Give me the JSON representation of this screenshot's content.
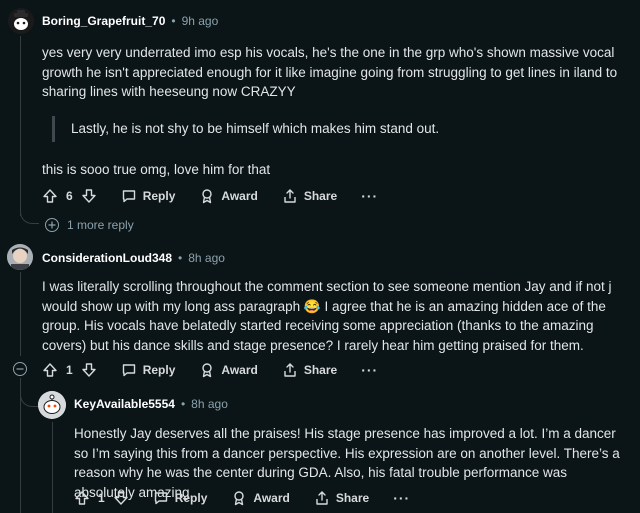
{
  "comments": [
    {
      "username": "Boring_Grapefruit_70",
      "time": "9h ago",
      "text": "yes very very underrated imo esp his vocals, he's the one in the grp who's shown massive vocal growth he isn't appreciated enough for it like imagine going from struggling to get lines in iland to sharing lines with heeseung now CRAZYY",
      "quote": "Lastly, he is not shy to be himself which makes him stand out.",
      "text2": "this is sooo true omg, love him for that",
      "score": "6",
      "more_replies": "1 more reply"
    },
    {
      "username": "ConsiderationLoud348",
      "time": "8h ago",
      "text": "I was literally scrolling throughout the comment section to see someone mention Jay and if not j would show up with my long ass paragraph 😂  I agree that he is an amazing hidden ace of the group. His vocals have belatedly started receiving some appreciation (thanks to the amazing covers) but his dance skills and stage presence? I rarely hear him getting praised for them.",
      "score": "1"
    },
    {
      "username": "KeyAvailable5554",
      "time": "8h ago",
      "text": "Honestly Jay deserves all the praises! His stage presence has improved a lot. I’m a dancer so I’m saying this from a dancer perspective. His expression are on another level. There’s a reason why he was the center during GDA. Also, his fatal trouble performance was absolutely amazing.",
      "score": "1"
    }
  ],
  "labels": {
    "reply": "Reply",
    "award": "Award",
    "share": "Share",
    "more": "···",
    "separator": "•"
  }
}
